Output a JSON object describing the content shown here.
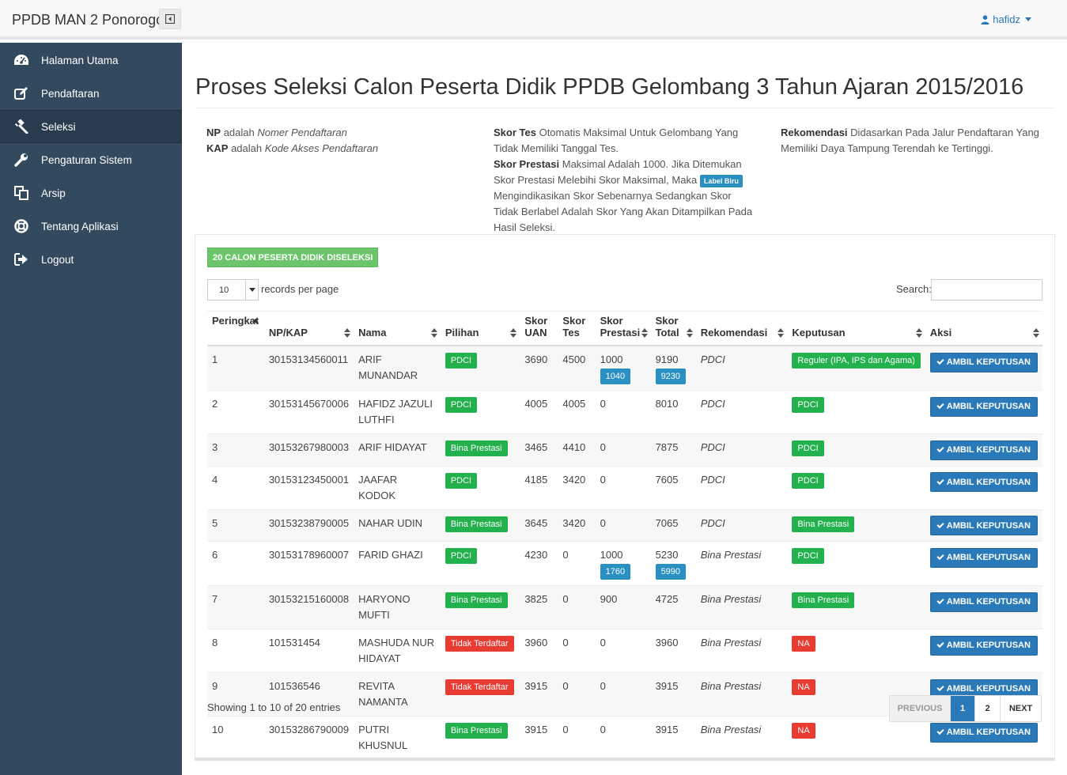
{
  "app": {
    "brand": "PPDB MAN 2 Ponorogo",
    "user": "hafidz"
  },
  "sidebar": {
    "items": [
      {
        "label": "Halaman Utama",
        "icon": "dashboard-icon"
      },
      {
        "label": "Pendaftaran",
        "icon": "edit-icon"
      },
      {
        "label": "Seleksi",
        "icon": "gavel-icon",
        "active": true
      },
      {
        "label": "Pengaturan Sistem",
        "icon": "wrench-icon"
      },
      {
        "label": "Arsip",
        "icon": "copy-icon"
      },
      {
        "label": "Tentang Aplikasi",
        "icon": "life-ring-icon"
      },
      {
        "label": "Logout",
        "icon": "sign-out-icon"
      }
    ]
  },
  "page": {
    "title": "Proses Seleksi Calon Peserta Didik PPDB Gelombang 3 Tahun Ajaran 2015/2016"
  },
  "info": {
    "np_term": "NP",
    "np_mid": "adalah",
    "np_def": "Nomer Pendaftaran",
    "kap_term": "KAP",
    "kap_mid": "adalah",
    "kap_def": "Kode Akses Pendaftaran",
    "skor_tes_term": "Skor Tes",
    "skor_tes_text": "Otomatis Maksimal Untuk Gelombang Yang Tidak Memiliki Tanggal Tes.",
    "skor_prestasi_term": "Skor Prestasi",
    "skor_prestasi_text1": "Maksimal Adalah 1000. Jika Ditemukan Skor Prestasi Melebihi Skor Maksimal, Maka",
    "label_biru": "Label Biru",
    "skor_prestasi_text2": "Mengindikasikan Skor Sebenarnya Sedangkan Skor Tidak Berlabel Adalah Skor Yang Akan Ditampilkan Pada Hasil Seleksi.",
    "rekomendasi_term": "Rekomendasi",
    "rekomendasi_text": "Didasarkan Pada Jalur Pendaftaran Yang Memiliki Daya Tampung Terendah ke Tertinggi."
  },
  "table_controls": {
    "count_label": "20 CALON PESERTA DIDIK DISELEKSI",
    "page_length": "10",
    "records_label": "records per page",
    "search_label": "Search:",
    "search_value": ""
  },
  "table": {
    "headers": {
      "peringkat": "Peringkat",
      "np_kap": "NP/KAP",
      "nama": "Nama",
      "pilihan": "Pilihan",
      "skor_uan_1": "Skor",
      "skor_uan_2": "UAN",
      "skor_tes_1": "Skor",
      "skor_tes_2": "Tes",
      "skor_prestasi_1": "Skor",
      "skor_prestasi_2": "Prestasi",
      "skor_total_1": "Skor",
      "skor_total_2": "Total",
      "rekomendasi": "Rekomendasi",
      "keputusan": "Keputusan",
      "aksi": "Aksi"
    },
    "action_label": "AMBIL KEPUTUSAN",
    "rows": [
      {
        "rank": "1",
        "np": "30153134560011",
        "nama": "ARIF MUNANDAR",
        "pilihan": "PDCI",
        "pilihan_color": "green",
        "uan": "3690",
        "tes": "4500",
        "prestasi": "1000",
        "prestasi_real": "1040",
        "total": "9190",
        "total_real": "9230",
        "rekomendasi": "PDCI",
        "keputusan": "Reguler (IPA, IPS dan Agama)",
        "keputusan_color": "green"
      },
      {
        "rank": "2",
        "np": "30153145670006",
        "nama": "HAFIDZ JAZULI LUTHFI",
        "pilihan": "PDCI",
        "pilihan_color": "green",
        "uan": "4005",
        "tes": "4005",
        "prestasi": "0",
        "prestasi_real": "",
        "total": "8010",
        "total_real": "",
        "rekomendasi": "PDCI",
        "keputusan": "PDCI",
        "keputusan_color": "green"
      },
      {
        "rank": "3",
        "np": "30153267980003",
        "nama": "ARIF HIDAYAT",
        "pilihan": "Bina Prestasi",
        "pilihan_color": "green",
        "uan": "3465",
        "tes": "4410",
        "prestasi": "0",
        "prestasi_real": "",
        "total": "7875",
        "total_real": "",
        "rekomendasi": "PDCI",
        "keputusan": "PDCI",
        "keputusan_color": "green"
      },
      {
        "rank": "4",
        "np": "30153123450001",
        "nama": "JAAFAR KODOK",
        "pilihan": "PDCI",
        "pilihan_color": "green",
        "uan": "4185",
        "tes": "3420",
        "prestasi": "0",
        "prestasi_real": "",
        "total": "7605",
        "total_real": "",
        "rekomendasi": "PDCI",
        "keputusan": "PDCI",
        "keputusan_color": "green"
      },
      {
        "rank": "5",
        "np": "30153238790005",
        "nama": "NAHAR UDIN",
        "pilihan": "Bina Prestasi",
        "pilihan_color": "green",
        "uan": "3645",
        "tes": "3420",
        "prestasi": "0",
        "prestasi_real": "",
        "total": "7065",
        "total_real": "",
        "rekomendasi": "PDCI",
        "keputusan": "Bina Prestasi",
        "keputusan_color": "green"
      },
      {
        "rank": "6",
        "np": "30153178960007",
        "nama": "FARID GHAZI",
        "pilihan": "PDCI",
        "pilihan_color": "green",
        "uan": "4230",
        "tes": "0",
        "prestasi": "1000",
        "prestasi_real": "1760",
        "total": "5230",
        "total_real": "5990",
        "rekomendasi": "Bina Prestasi",
        "keputusan": "PDCI",
        "keputusan_color": "green"
      },
      {
        "rank": "7",
        "np": "30153215160008",
        "nama": "HARYONO MUFTI",
        "pilihan": "Bina Prestasi",
        "pilihan_color": "green",
        "uan": "3825",
        "tes": "0",
        "prestasi": "900",
        "prestasi_real": "",
        "total": "4725",
        "total_real": "",
        "rekomendasi": "Bina Prestasi",
        "keputusan": "Bina Prestasi",
        "keputusan_color": "green"
      },
      {
        "rank": "8",
        "np": "101531454",
        "nama": "MASHUDA NUR HIDAYAT",
        "pilihan": "Tidak Terdaftar",
        "pilihan_color": "red",
        "uan": "3960",
        "tes": "0",
        "prestasi": "0",
        "prestasi_real": "",
        "total": "3960",
        "total_real": "",
        "rekomendasi": "Bina Prestasi",
        "keputusan": "NA",
        "keputusan_color": "red"
      },
      {
        "rank": "9",
        "np": "101536546",
        "nama": "REVITA NAMANTA",
        "pilihan": "Tidak Terdaftar",
        "pilihan_color": "red",
        "uan": "3915",
        "tes": "0",
        "prestasi": "0",
        "prestasi_real": "",
        "total": "3915",
        "total_real": "",
        "rekomendasi": "Bina Prestasi",
        "keputusan": "NA",
        "keputusan_color": "red"
      },
      {
        "rank": "10",
        "np": "30153286790009",
        "nama": "PUTRI KHUSNUL",
        "pilihan": "Bina Prestasi",
        "pilihan_color": "green",
        "uan": "3915",
        "tes": "0",
        "prestasi": "0",
        "prestasi_real": "",
        "total": "3915",
        "total_real": "",
        "rekomendasi": "Bina Prestasi",
        "keputusan": "NA",
        "keputusan_color": "red"
      }
    ]
  },
  "footer": {
    "showing": "Showing 1 to 10 of 20 entries",
    "prev": "PREVIOUS",
    "page1": "1",
    "page2": "2",
    "next": "NEXT"
  },
  "colors": {
    "sidebar_bg": "#334a5e",
    "primary_blue": "#2a7ab9",
    "label_blue": "#2a8fc1",
    "success_green": "#22b14c",
    "danger_red": "#e83b32"
  }
}
